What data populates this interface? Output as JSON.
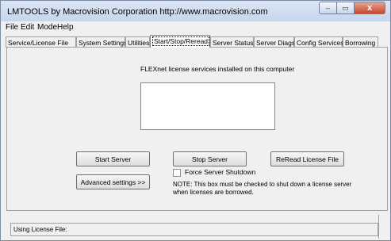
{
  "window": {
    "title": "LMTOOLS by Macrovision Corporation http://www.macrovision.com",
    "minimize_label": "–",
    "maximize_label": "▭",
    "close_label": "x"
  },
  "menu": {
    "items": [
      "File",
      "Edit",
      "Mode",
      "Help"
    ]
  },
  "tabs": [
    {
      "label": "Service/License File",
      "active": false
    },
    {
      "label": "System Settings",
      "active": false
    },
    {
      "label": "Utilities",
      "active": false
    },
    {
      "label": "Start/Stop/Reread",
      "active": true
    },
    {
      "label": "Server Status",
      "active": false
    },
    {
      "label": "Server Diags",
      "active": false
    },
    {
      "label": "Config Services",
      "active": false
    },
    {
      "label": "Borrowing",
      "active": false
    }
  ],
  "panel": {
    "services_label": "FLEXnet license services installed on this computer",
    "start_server": "Start Server",
    "stop_server": "Stop Server",
    "reread_license": "ReRead License File",
    "advanced_settings": "Advanced settings >>",
    "force_shutdown_label": "Force Server Shutdown",
    "force_shutdown_checked": false,
    "note": "NOTE:  This box must be checked to shut down a license server when licenses are borrowed."
  },
  "status": {
    "text": "Using License File:"
  }
}
